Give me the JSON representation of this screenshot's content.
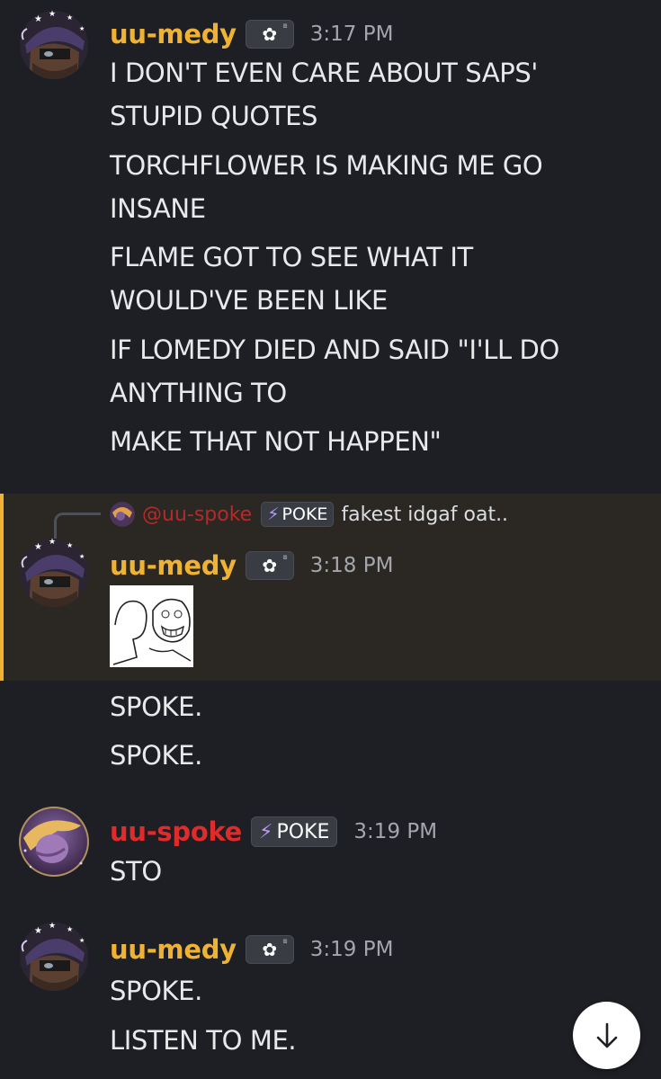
{
  "messages": [
    {
      "author": "uu-medy",
      "time": "3:17 PM",
      "lines": [
        "I DON'T EVEN CARE ABOUT SAPS'",
        "STUPID QUOTES",
        "TORCHFLOWER IS MAKING ME GO",
        "INSANE",
        "FLAME GOT TO SEE WHAT IT",
        "WOULD'VE BEEN LIKE",
        "IF LOMEDY DIED AND SAID \"I'LL DO",
        "ANYTHING TO",
        "MAKE THAT NOT HAPPEN\""
      ]
    },
    {
      "reply": {
        "mention": "@uu-spoke",
        "tag": "POKE",
        "text": "fakest idgaf oat.."
      },
      "author": "uu-medy",
      "time": "3:18 PM",
      "lines": [
        "SPOKE.",
        "SPOKE."
      ]
    },
    {
      "author": "uu-spoke",
      "tag": "POKE",
      "time": "3:19 PM",
      "lines": [
        "STO"
      ]
    },
    {
      "author": "uu-medy",
      "time": "3:19 PM",
      "lines": [
        "SPOKE.",
        "LISTEN TO ME."
      ]
    }
  ],
  "role_badge_icon": "flower-icon",
  "tag_icon": "lightning-bolt-icon",
  "jump_button_icon": "arrow-down-icon",
  "colors": {
    "background": "#1e1f24",
    "medy_name": "#f0b232",
    "spoke_name": "#e02b2b",
    "highlight": "#2b2823",
    "highlight_bar": "#f0b232",
    "timestamp": "#a3a6ad"
  }
}
